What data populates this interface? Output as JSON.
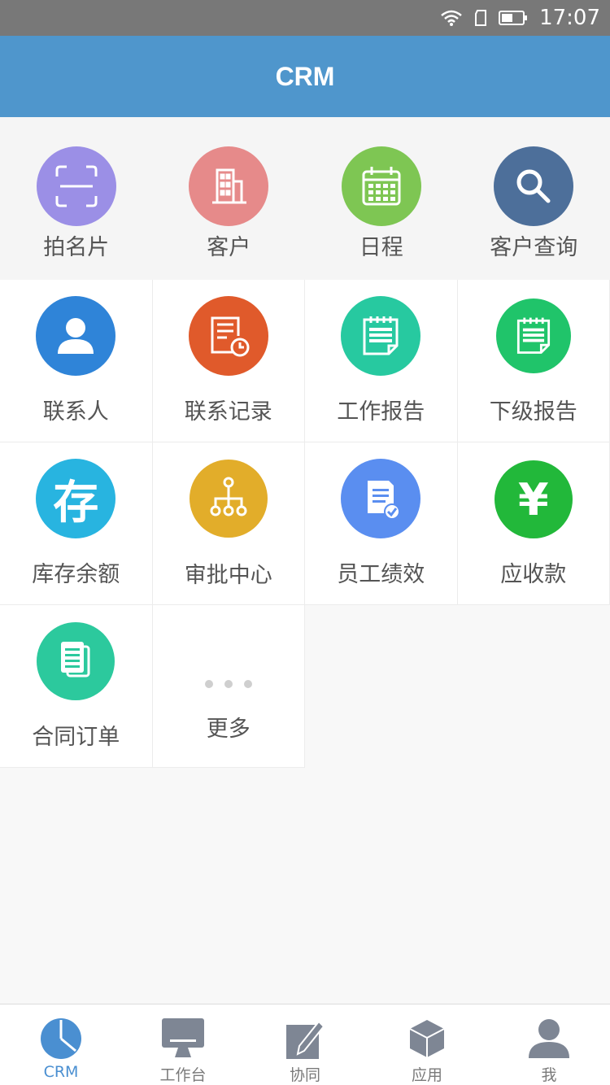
{
  "status_bar": {
    "time": "17:07",
    "icons": [
      "wifi-icon",
      "sim-icon",
      "battery-icon"
    ]
  },
  "header": {
    "title": "CRM"
  },
  "colors": {
    "header_bg": "#4f96cc",
    "status_bg": "#787878",
    "active_tab": "#4a8fd1",
    "icon_scan": "#9b8fe6",
    "icon_customer": "#e68a8a",
    "icon_schedule": "#7ec653",
    "icon_customer_query": "#4d6f9a",
    "icon_contact": "#2f84d8",
    "icon_contact_record": "#e05a2b",
    "icon_work_report": "#27c9a0",
    "icon_sub_report": "#20c46a",
    "icon_inventory": "#28b4e0",
    "icon_approval": "#e2ad2a",
    "icon_performance": "#5a8ef0",
    "icon_receivable": "#22b83a",
    "icon_contract": "#2cc99d"
  },
  "top_items": [
    {
      "label": "拍名片",
      "icon": "scan-card-icon"
    },
    {
      "label": "客户",
      "icon": "building-icon"
    },
    {
      "label": "日程",
      "icon": "calendar-icon"
    },
    {
      "label": "客户查询",
      "icon": "search-icon"
    }
  ],
  "grid_items": [
    {
      "label": "联系人",
      "icon": "person-icon"
    },
    {
      "label": "联系记录",
      "icon": "record-clock-icon"
    },
    {
      "label": "工作报告",
      "icon": "notepad-icon"
    },
    {
      "label": "下级报告",
      "icon": "notepad-icon"
    },
    {
      "label": "库存余额",
      "icon": "cun-icon",
      "glyph": "存"
    },
    {
      "label": "审批中心",
      "icon": "org-tree-icon"
    },
    {
      "label": "员工绩效",
      "icon": "document-check-icon"
    },
    {
      "label": "应收款",
      "icon": "yen-icon",
      "glyph": "¥"
    },
    {
      "label": "合同订单",
      "icon": "documents-icon"
    },
    {
      "label": "更多",
      "icon": "more-dots-icon"
    }
  ],
  "bottom_nav": [
    {
      "label": "CRM",
      "icon": "pie-chart-icon",
      "active": true
    },
    {
      "label": "工作台",
      "icon": "monitor-icon",
      "active": false
    },
    {
      "label": "协同",
      "icon": "pencil-icon",
      "active": false
    },
    {
      "label": "应用",
      "icon": "cube-icon",
      "active": false
    },
    {
      "label": "我",
      "icon": "user-icon",
      "active": false
    }
  ]
}
